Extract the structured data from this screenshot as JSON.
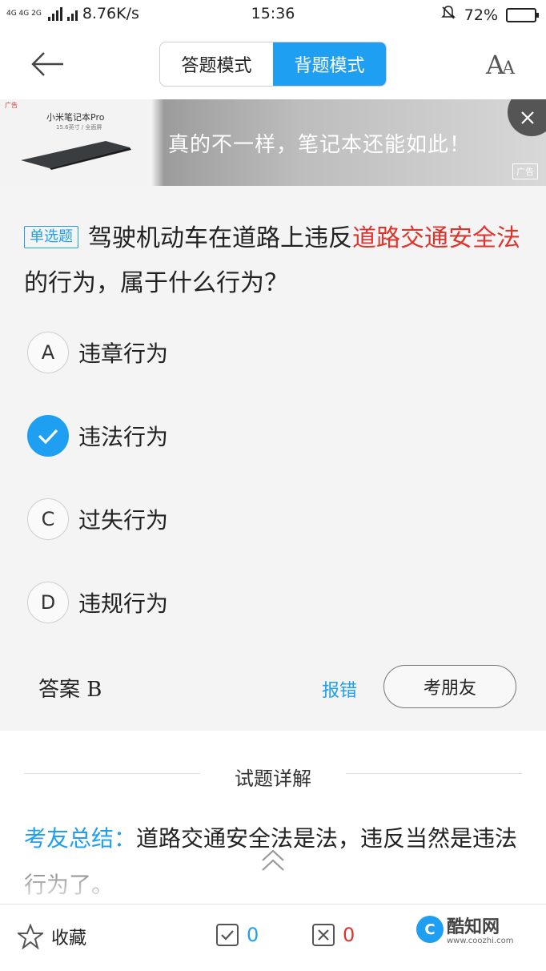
{
  "status_bar": {
    "network_tags": "4G 4G 2G",
    "speed": "8.76K/s",
    "time": "15:36",
    "battery": "72%",
    "battery_level": 0.72,
    "battery_color": "#3ec43e"
  },
  "header": {
    "mode_tabs": [
      {
        "label": "答题模式",
        "active": false
      },
      {
        "label": "背题模式",
        "active": true
      }
    ],
    "font_button": "AA"
  },
  "ad": {
    "brand": "广告",
    "product": "小米笔记本Pro",
    "subtitle": "15.6英寸 / 全面屏",
    "slogan": "真的不一样，笔记本还能如此！",
    "label": "广告"
  },
  "question": {
    "type_badge": "单选题",
    "text_before": "驾驶机动车在道路上违反",
    "text_highlight_1": "道路交通安全法",
    "text_after": "的行为，属于什么行为？",
    "options": [
      {
        "letter": "A",
        "text": "违章行为",
        "checked": false
      },
      {
        "letter": "B",
        "text": "违法行为",
        "checked": true
      },
      {
        "letter": "C",
        "text": "过失行为",
        "checked": false
      },
      {
        "letter": "D",
        "text": "违规行为",
        "checked": false
      }
    ],
    "answer_label": "答案 B",
    "report_label": "报错",
    "ask_label": "考朋友"
  },
  "explanation": {
    "title": "试题详解",
    "prefix": "考友总结：",
    "text": "道路交通安全法是法，违反当然是违法行为了。"
  },
  "bottom_bar": {
    "favorite_label": "收藏",
    "correct_count": "0",
    "wrong_count": "0",
    "watermark_name": "酷知网",
    "watermark_url": "www.coozhi.com"
  },
  "colors": {
    "accent": "#1e9ff2",
    "highlight": "#e0332b"
  }
}
